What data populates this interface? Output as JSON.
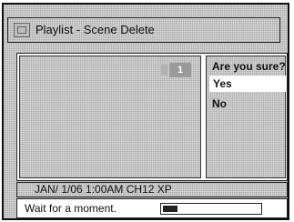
{
  "header": {
    "title": "Playlist - Scene Delete"
  },
  "preview": {
    "badge": "1"
  },
  "confirm": {
    "question": "Are you sure?",
    "options": [
      {
        "label": "Yes",
        "selected": true
      },
      {
        "label": "No",
        "selected": false
      }
    ]
  },
  "info": {
    "text": "JAN/ 1/06 1:00AM CH12 XP"
  },
  "status": {
    "text": "Wait for a moment.",
    "progress": 0.15
  },
  "icons": {
    "title_icon": "playlist-icon"
  }
}
